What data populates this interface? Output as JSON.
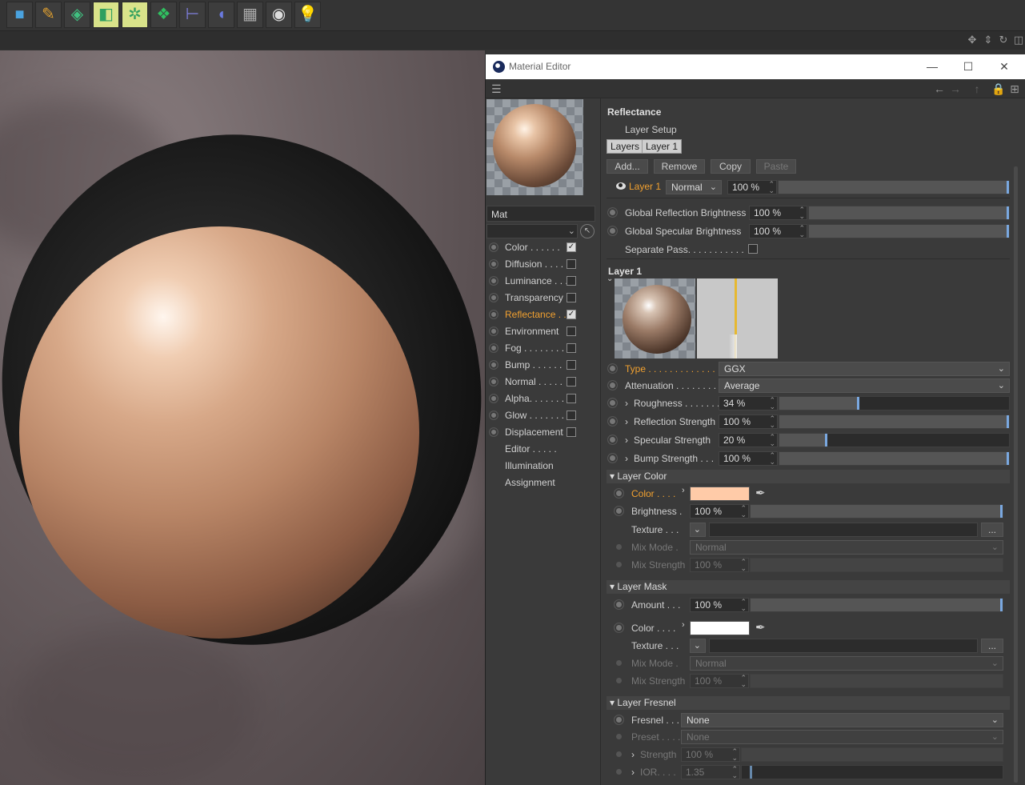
{
  "toolbar": {
    "buttons": [
      {
        "name": "cube-icon",
        "glyph": "■",
        "color": "#4aa3e0"
      },
      {
        "name": "pen-icon",
        "glyph": "✎",
        "color": "#e0a030"
      },
      {
        "name": "subdivision-icon",
        "glyph": "◈",
        "color": "#40c080"
      },
      {
        "name": "extrude-icon",
        "glyph": "◧",
        "color": "#30a060",
        "active": true
      },
      {
        "name": "mograph-cloner-icon",
        "glyph": "✲",
        "color": "#30a060",
        "active": true
      },
      {
        "name": "deformer-icon",
        "glyph": "❖",
        "color": "#30c060"
      },
      {
        "name": "bend-icon",
        "glyph": "⊢",
        "color": "#8080e0"
      },
      {
        "name": "field-icon",
        "glyph": "◖",
        "color": "#6a7ae0"
      },
      {
        "name": "floor-icon",
        "glyph": "▦",
        "color": "#aaaaaa"
      },
      {
        "name": "camera-icon",
        "glyph": "◉",
        "color": "#dddddd"
      },
      {
        "name": "light-icon",
        "glyph": "💡",
        "color": "#dddddd"
      }
    ]
  },
  "editor": {
    "title": "Material Editor",
    "material_name": "Mat",
    "channels": [
      {
        "label": "Color . . . . . .",
        "checked": true,
        "dot": true
      },
      {
        "label": "Diffusion . . . .",
        "checked": false,
        "dot": true
      },
      {
        "label": "Luminance . . .",
        "checked": false,
        "dot": true
      },
      {
        "label": "Transparency",
        "checked": false,
        "dot": true
      },
      {
        "label": "Reflectance . .",
        "checked": true,
        "dot": true,
        "active": true
      },
      {
        "label": "Environment",
        "checked": false,
        "dot": true
      },
      {
        "label": "Fog . . . . . . . .",
        "checked": false,
        "dot": true
      },
      {
        "label": "Bump . . . . . .",
        "checked": false,
        "dot": true
      },
      {
        "label": "Normal . . . . .",
        "checked": false,
        "dot": true
      },
      {
        "label": "Alpha. . . . . . .",
        "checked": false,
        "dot": true
      },
      {
        "label": "Glow . . . . . . .",
        "checked": false,
        "dot": true
      },
      {
        "label": "Displacement",
        "checked": false,
        "dot": true
      },
      {
        "label": "Editor . . . . .",
        "checked": null,
        "dot": false
      },
      {
        "label": "Illumination",
        "checked": null,
        "dot": false
      },
      {
        "label": "Assignment",
        "checked": null,
        "dot": false
      }
    ],
    "reflectance": {
      "title": "Reflectance",
      "layer_setup": "Layer Setup",
      "tabs": [
        "Layers",
        "Layer 1"
      ],
      "buttons": [
        "Add...",
        "Remove",
        "Copy",
        "Paste"
      ],
      "layer_row": {
        "name": "Layer 1",
        "mode": "Normal",
        "amount": "100 %",
        "amount_frac": 1.0
      },
      "global_reflection": {
        "label": "Global Reflection Brightness",
        "value": "100 %",
        "frac": 1.0
      },
      "global_specular": {
        "label": "Global Specular Brightness",
        "value": "100 %",
        "frac": 1.0
      },
      "separate_pass": "Separate Pass. . . . . . . . . . .",
      "layer_title": "Layer 1",
      "type": {
        "label": "Type . . . . . . . . . . . . . .",
        "value": "GGX"
      },
      "attenuation": {
        "label": "Attenuation . . . . . . . .",
        "value": "Average"
      },
      "roughness": {
        "label": "Roughness . . . . . . .",
        "value": "34 %",
        "frac": 0.34
      },
      "refl_strength": {
        "label": "Reflection Strength",
        "value": "100 %",
        "frac": 1.0
      },
      "spec_strength": {
        "label": "Specular Strength",
        "value": "20 %",
        "frac": 0.2
      },
      "bump_strength": {
        "label": "Bump Strength . . .",
        "value": "100 %",
        "frac": 1.0
      },
      "layer_color": {
        "header": "Layer Color",
        "color_label": "Color . . . .",
        "color_hex": "#ffcba8",
        "brightness_label": "Brightness .",
        "brightness_value": "100 %",
        "brightness_frac": 1.0,
        "texture_label": "Texture . . .",
        "texture_more": "...",
        "mixmode_label": "Mix Mode .",
        "mixmode_value": "Normal",
        "mixstrength_label": "Mix Strength",
        "mixstrength_value": "100 %"
      },
      "layer_mask": {
        "header": "Layer Mask",
        "amount_label": "Amount . . .",
        "amount_value": "100 %",
        "amount_frac": 1.0,
        "color_label": "Color . . . .",
        "color_hex": "#ffffff",
        "texture_label": "Texture . . .",
        "texture_more": "...",
        "mixmode_label": "Mix Mode .",
        "mixmode_value": "Normal",
        "mixstrength_label": "Mix Strength",
        "mixstrength_value": "100 %"
      },
      "layer_fresnel": {
        "header": "Layer Fresnel",
        "fresnel_label": "Fresnel . . .",
        "fresnel_value": "None",
        "preset_label": "Preset . . . .",
        "preset_value": "None",
        "strength_label": "Strength",
        "strength_value": "100 %",
        "ior_label": "IOR. . . .",
        "ior_value": "1.35"
      }
    }
  }
}
